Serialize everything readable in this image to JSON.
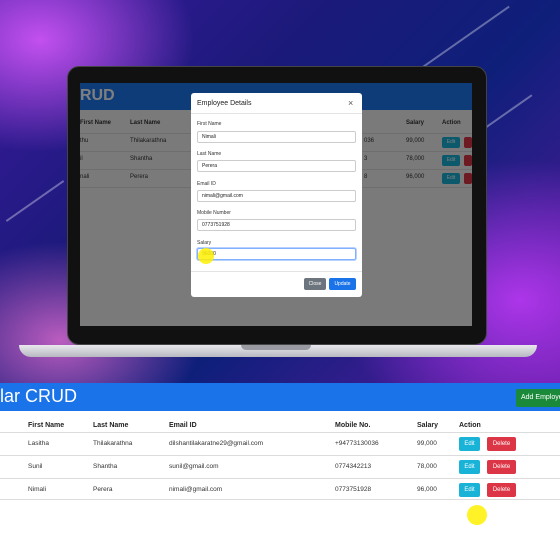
{
  "colors": {
    "primary": "#1a73e8",
    "success": "#1a8a3a",
    "info": "#19b3d8",
    "danger": "#dc3545",
    "secondary": "#6c757d"
  },
  "laptop_screen": {
    "title": "RUD",
    "headers": [
      "First Name",
      "Last Name",
      "Salary",
      "Action"
    ],
    "rows": [
      {
        "first": "thu",
        "last": "Thilakarathna",
        "partial": "036",
        "salary": "99,000",
        "edit": "Edit"
      },
      {
        "first": "il",
        "last": "Shantha",
        "partial": "3",
        "salary": "78,000",
        "edit": "Edit"
      },
      {
        "first": "nali",
        "last": "Perera",
        "partial": "8",
        "salary": "96,000",
        "edit": "Edit"
      }
    ]
  },
  "modal": {
    "title": "Employee Details",
    "close_icon": "×",
    "fields": {
      "first_name": {
        "label": "First Name",
        "value": "Nimali"
      },
      "last_name": {
        "label": "Last Name",
        "value": "Perera"
      },
      "email": {
        "label": "Email ID",
        "value": "nimali@gmail.com"
      },
      "mobile": {
        "label": "Mobile Number",
        "value": "0773751928"
      },
      "salary": {
        "label": "Salary",
        "value": "96000"
      }
    },
    "close_label": "Close",
    "update_label": "Update"
  },
  "app": {
    "title": "lar CRUD",
    "add_label": "Add Employee",
    "headers": {
      "first": "First Name",
      "last": "Last Name",
      "email": "Email ID",
      "mobile": "Mobile No.",
      "salary": "Salary",
      "action": "Action"
    },
    "rows": [
      {
        "first": "Lasitha",
        "last": "Thilakarathna",
        "email": "dilshantilakaratne29@gmail.com",
        "mobile": "+94773130036",
        "salary": "99,000"
      },
      {
        "first": "Sunil",
        "last": "Shantha",
        "email": "sunil@gmail.com",
        "mobile": "0774342213",
        "salary": "78,000"
      },
      {
        "first": "Nimali",
        "last": "Perera",
        "email": "nimali@gmail.com",
        "mobile": "0773751928",
        "salary": "96,000"
      }
    ],
    "edit_label": "Edit",
    "delete_label": "Delete"
  }
}
